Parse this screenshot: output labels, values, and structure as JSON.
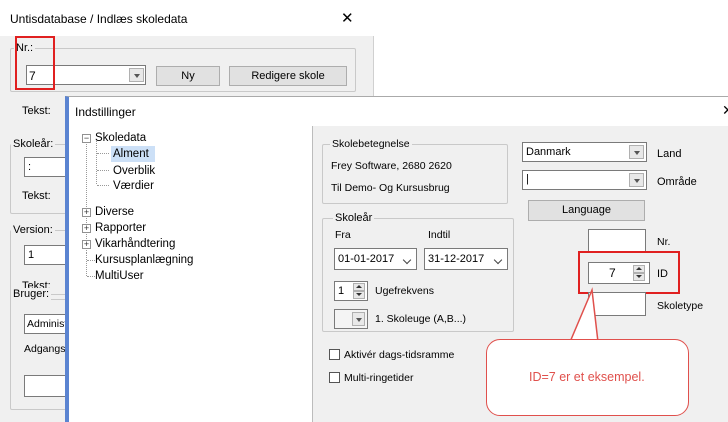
{
  "bg_window": {
    "title": "Untisdatabase / Indlæs skoledata",
    "close_glyph": "✕",
    "nr": {
      "legend": "Nr.:",
      "value": "7",
      "ny_button": "Ny",
      "edit_button": "Redigere skole"
    },
    "tekst_label_1": "Tekst:",
    "skoleaar": {
      "legend": "Skoleår:",
      "value": ":"
    },
    "tekst_label_2": "Tekst:",
    "version": {
      "legend": "Version:",
      "value": "1"
    },
    "tekst_label_3": "Tekst:",
    "bruger": {
      "legend": "Bruger:",
      "value": "Administr",
      "adgang_label": "Adgangsl"
    }
  },
  "fg_window": {
    "title": "Indstillinger",
    "tree": [
      {
        "label": "Skoledata",
        "expander": "−"
      },
      {
        "label": "Alment"
      },
      {
        "label": "Overblik"
      },
      {
        "label": "Værdier"
      },
      {
        "label": "Diverse",
        "expander": "+"
      },
      {
        "label": "Rapporter",
        "expander": "+"
      },
      {
        "label": "Vikarhåndtering",
        "expander": "+"
      },
      {
        "label": "Kursusplanlægning"
      },
      {
        "label": "MultiUser"
      }
    ],
    "skolebetegnelse": {
      "legend": "Skolebetegnelse",
      "line1": "Frey Software, 2680 2620",
      "line2": "Til Demo- Og Kursusbrug"
    },
    "skoleaar": {
      "legend": "Skoleår",
      "from_label": "Fra",
      "to_label": "Indtil",
      "from_value": "01-01-2017",
      "to_value": "31-12-2017",
      "ugefrekvens_value": "1",
      "ugefrekvens_label": "Ugefrekvens",
      "skoleuge_label": "1. Skoleuge (A,B...)"
    },
    "dagstidsramme_label": "Aktivér dags-tidsramme",
    "multiringetider_label": "Multi-ringetider",
    "land": {
      "value": "Danmark",
      "label": "Land"
    },
    "omraade": {
      "value": "|",
      "label": "Område"
    },
    "language_button": "Language",
    "nr_label": "Nr.",
    "id": {
      "value": "7",
      "label": "ID"
    },
    "skoletype_label": "Skoletype"
  },
  "callout_text": "ID=7 er et eksempel.",
  "colors": {
    "highlight_red": "#e02020",
    "callout_text": "#e0504c",
    "accent_blue": "#5b84d1"
  }
}
